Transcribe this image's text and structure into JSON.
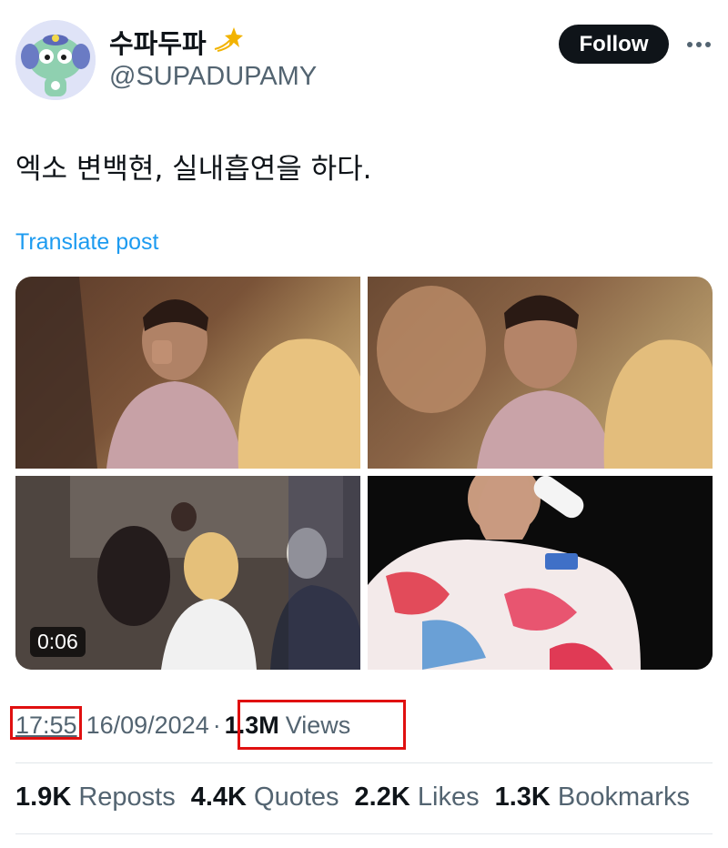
{
  "author": {
    "display_name": "수파두파",
    "name_badge_icon": "dizzy-star-icon",
    "handle": "@SUPADUPAMY",
    "follow_label": "Follow"
  },
  "post": {
    "text": "엑소 변백현, 실내흡연을 하다.",
    "translate_label": "Translate post",
    "media": {
      "video_duration": "0:06"
    },
    "time": "17:55",
    "date": "16/09/2024",
    "separator": "·",
    "views_count": "1.3M",
    "views_label": "Views"
  },
  "stats": [
    {
      "count": "1.9K",
      "label": "Reposts"
    },
    {
      "count": "4.4K",
      "label": "Quotes"
    },
    {
      "count": "2.2K",
      "label": "Likes"
    },
    {
      "count": "1.3K",
      "label": "Bookmarks"
    }
  ],
  "colors": {
    "link": "#1d9bf0",
    "highlight_box": "#e01010",
    "follow_button": "#0f1419"
  }
}
